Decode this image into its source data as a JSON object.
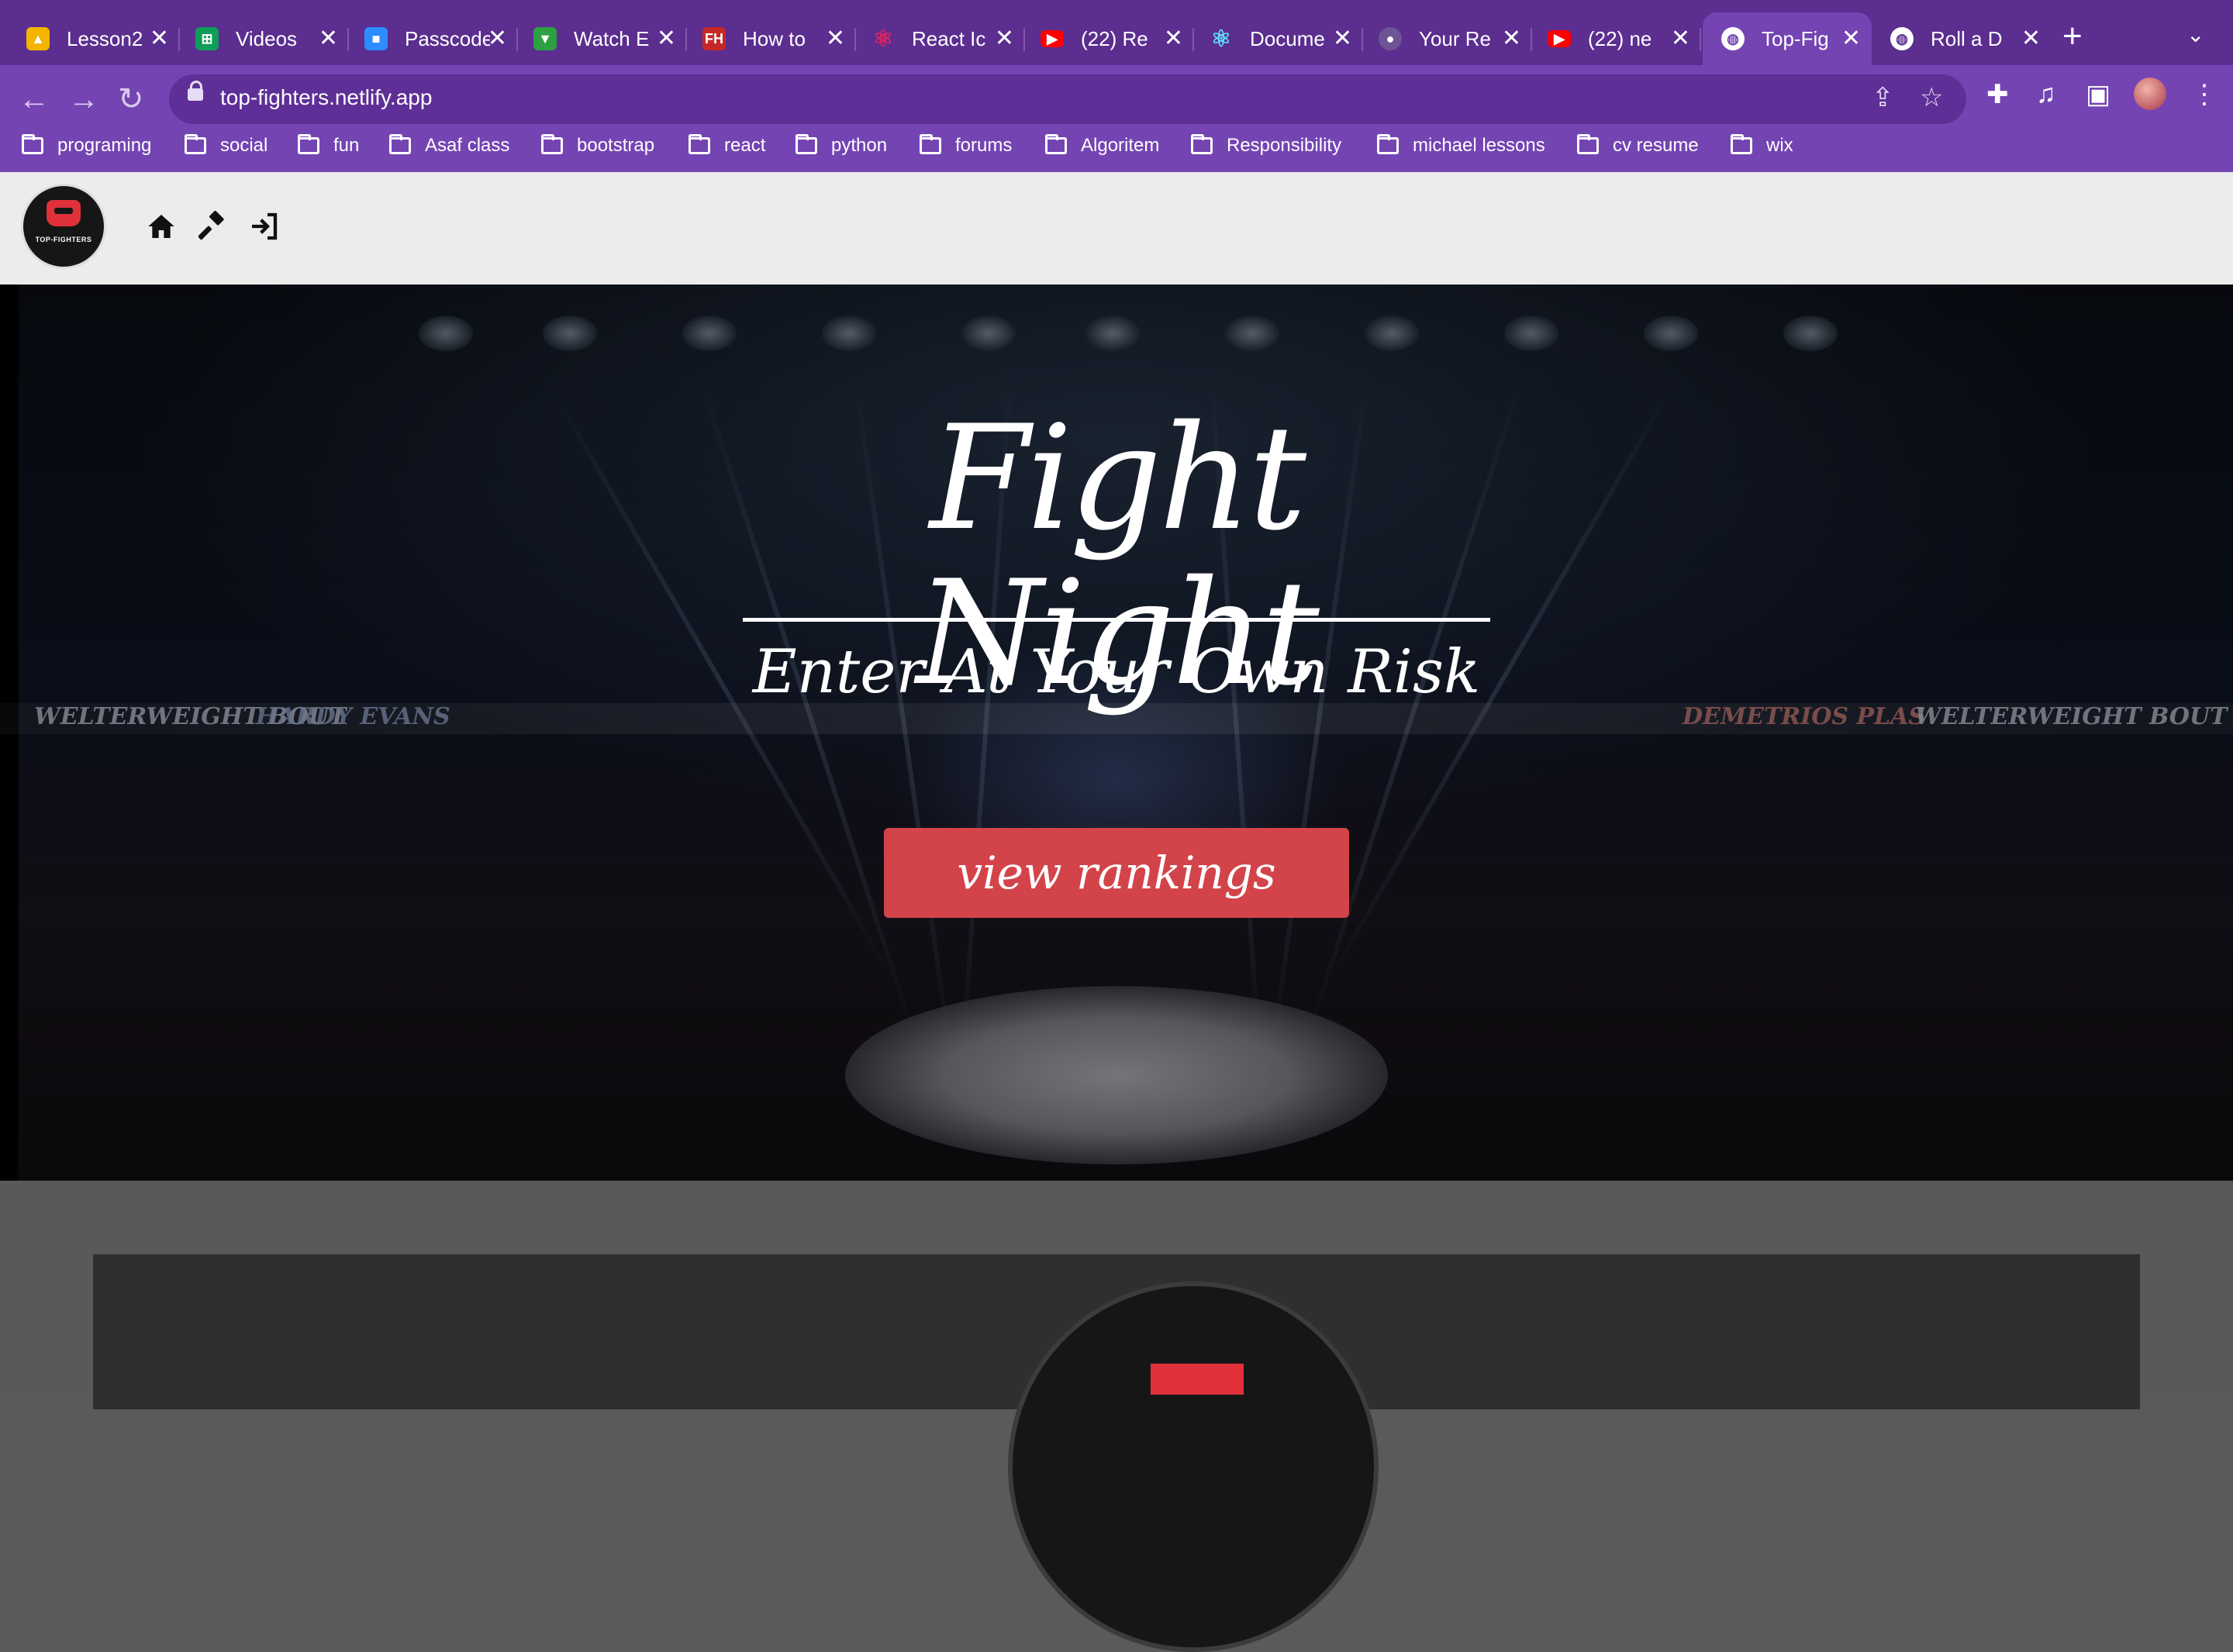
{
  "browser": {
    "tabs": [
      {
        "title": "Lesson2",
        "icon": "google-drive-icon",
        "color": "#f4b400"
      },
      {
        "title": "Videos",
        "icon": "google-sheets-icon",
        "color": "#0f9d58"
      },
      {
        "title": "Passcode",
        "icon": "zoom-icon",
        "color": "#2d8cff"
      },
      {
        "title": "Watch E",
        "icon": "tv-icon",
        "color": "#2ea043"
      },
      {
        "title": "How to",
        "icon": "fh-icon",
        "color": "#c62828"
      },
      {
        "title": "React Ic",
        "icon": "react-icon",
        "color": "#e0245e"
      },
      {
        "title": "(22) Re",
        "icon": "youtube-icon",
        "color": "#ff0000"
      },
      {
        "title": "Docume",
        "icon": "react-icon",
        "color": "#61dafb"
      },
      {
        "title": "Your Re",
        "icon": "github-icon",
        "color": "#6e5494"
      },
      {
        "title": "(22) ne",
        "icon": "youtube-icon",
        "color": "#ff0000"
      },
      {
        "title": "Top-Fig",
        "icon": "globe-icon",
        "color": "#ffffff"
      },
      {
        "title": "Roll a D",
        "icon": "globe-icon",
        "color": "#ffffff"
      }
    ],
    "url": "top-fighters.netlify.app",
    "bookmarks": [
      "programing",
      "social",
      "fun",
      "Asaf class",
      "bootstrap",
      "react",
      "python",
      "forums",
      "Algoritem",
      "Responsibility",
      "michael lessons",
      "cv resume",
      "wix"
    ]
  },
  "site": {
    "logo_text": "TOP-FIGHTERS",
    "hero": {
      "title": "Fight Night",
      "subtitle": "Enter At Your Own Risk",
      "cta": "view rankings"
    },
    "banners": [
      "WELTERWEIGHT BOUT",
      "HARDY EVANS",
      "DEMETRIOS PLAS",
      "WELTERWEIGHT BOUT"
    ]
  }
}
